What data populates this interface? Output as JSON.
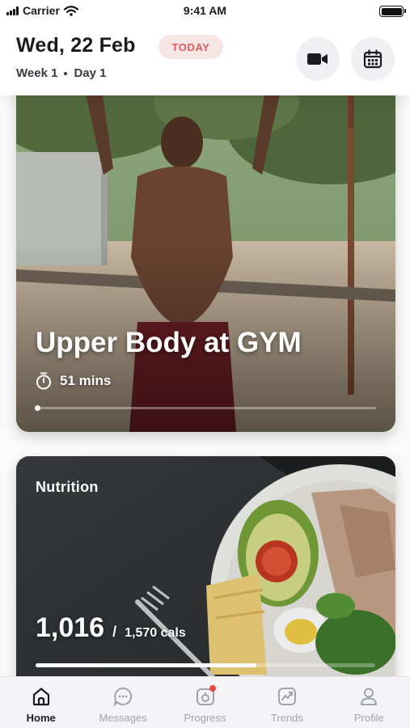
{
  "status_bar": {
    "carrier": "Carrier",
    "time": "9:41 AM"
  },
  "header": {
    "date": "Wed, 22 Feb",
    "today_badge": "TODAY",
    "week": "Week 1",
    "day": "Day 1",
    "video_icon": "video-camera-icon",
    "calendar_icon": "calendar-icon"
  },
  "workout_card": {
    "title": "Upper Body at GYM",
    "duration": "51 mins",
    "timer_icon": "stopwatch-icon",
    "progress_fraction": 0.0
  },
  "nutrition_card": {
    "label": "Nutrition",
    "calories_consumed": "1,016",
    "separator": "/",
    "calories_goal": "1,570 cals",
    "progress_fraction": 0.65
  },
  "tab_bar": {
    "items": [
      {
        "label": "Home",
        "icon": "home-icon",
        "active": true
      },
      {
        "label": "Messages",
        "icon": "chat-bubble-icon",
        "active": false
      },
      {
        "label": "Progress",
        "icon": "progress-icon",
        "active": false,
        "badge": true
      },
      {
        "label": "Trends",
        "icon": "trend-chart-icon",
        "active": false
      },
      {
        "label": "Profile",
        "icon": "profile-icon",
        "active": false
      }
    ]
  },
  "colors": {
    "accent_red": "#e05a5a",
    "badge_bg": "#f6e5e5",
    "notification": "#e8493f",
    "text_primary": "#1b1b1f",
    "tab_inactive": "#a2a2aa"
  }
}
